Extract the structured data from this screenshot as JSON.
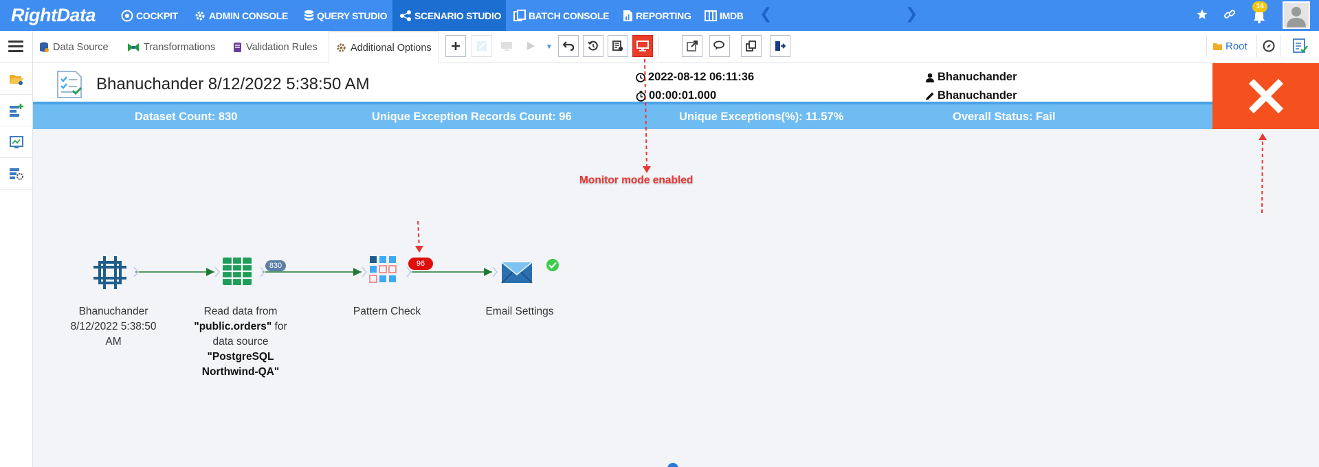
{
  "app": {
    "logo_text": "RightData",
    "notification_count": "14"
  },
  "nav": {
    "items": [
      {
        "label": "COCKPIT",
        "icon": "cockpit-icon"
      },
      {
        "label": "ADMIN CONSOLE",
        "icon": "gear-icon"
      },
      {
        "label": "QUERY STUDIO",
        "icon": "database-icon"
      },
      {
        "label": "SCENARIO STUDIO",
        "icon": "workflow-icon",
        "active": true
      },
      {
        "label": "BATCH CONSOLE",
        "icon": "batch-icon"
      },
      {
        "label": "REPORTING",
        "icon": "report-icon"
      },
      {
        "label": "IMDB",
        "icon": "columns-icon"
      }
    ]
  },
  "tabs": {
    "data_source": "Data Source",
    "transformations": "Transformations",
    "validation_rules": "Validation Rules",
    "additional_options": "Additional Options"
  },
  "toolbar": {
    "root_label": "Root"
  },
  "result": {
    "title": "Bhanuchander 8/12/2022 5:38:50 AM",
    "run_datetime": "2022-08-12 06:11:36",
    "duration": "00:00:01.000",
    "created_by": "Bhanuchander",
    "modified_by": "Bhanuchander",
    "dataset_count": "Dataset Count: 830",
    "unique_exception_records": "Unique Exception Records Count: 96",
    "unique_exceptions_pct": "Unique Exceptions(%): 11.57%",
    "overall_status": "Overall Status: Fail",
    "status_color": "#f4511e"
  },
  "canvas": {
    "monitor_note": "Monitor mode enabled",
    "nodes": [
      {
        "label_lines": [
          "Bhanuchander",
          "8/12/2022 5:38:50",
          "AM"
        ]
      },
      {
        "label_pre": "Read data from",
        "label_bold1": "\"public.orders\"",
        "label_mid": " for",
        "label_line3": "data source",
        "label_bold2": "\"PostgreSQL",
        "label_bold3": "Northwind-QA\""
      },
      {
        "label": "Pattern Check"
      },
      {
        "label": "Email Settings"
      }
    ],
    "record_count_badge": "830",
    "exception_count_badge": "96"
  }
}
